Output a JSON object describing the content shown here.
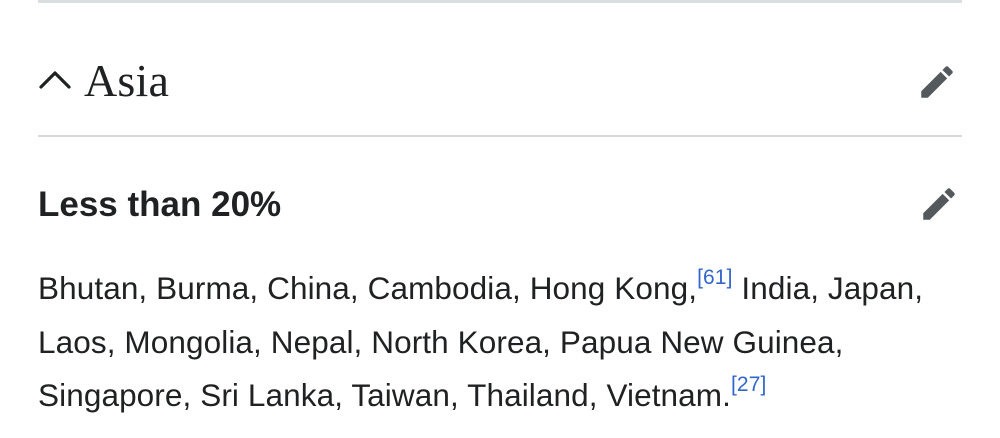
{
  "section": {
    "title": "Asia",
    "chevron_icon": "chevron-up-icon",
    "edit_icon": "pencil-icon"
  },
  "subsection": {
    "title": "Less than 20%",
    "edit_icon": "pencil-icon"
  },
  "paragraph": {
    "text_part1": "Bhutan, Burma, China, Cambodia, Hong Kong,",
    "ref1": "[61]",
    "text_part2": " India, Japan, Laos, Mongolia, Nepal, North Korea, Papua New Guinea, Singapore, Sri Lanka, Taiwan, Thailand, Vietnam.",
    "ref2": "[27]"
  },
  "colors": {
    "text": "#202122",
    "link": "#3366cc",
    "icon": "#54595d",
    "divider": "#d6d8dc"
  }
}
